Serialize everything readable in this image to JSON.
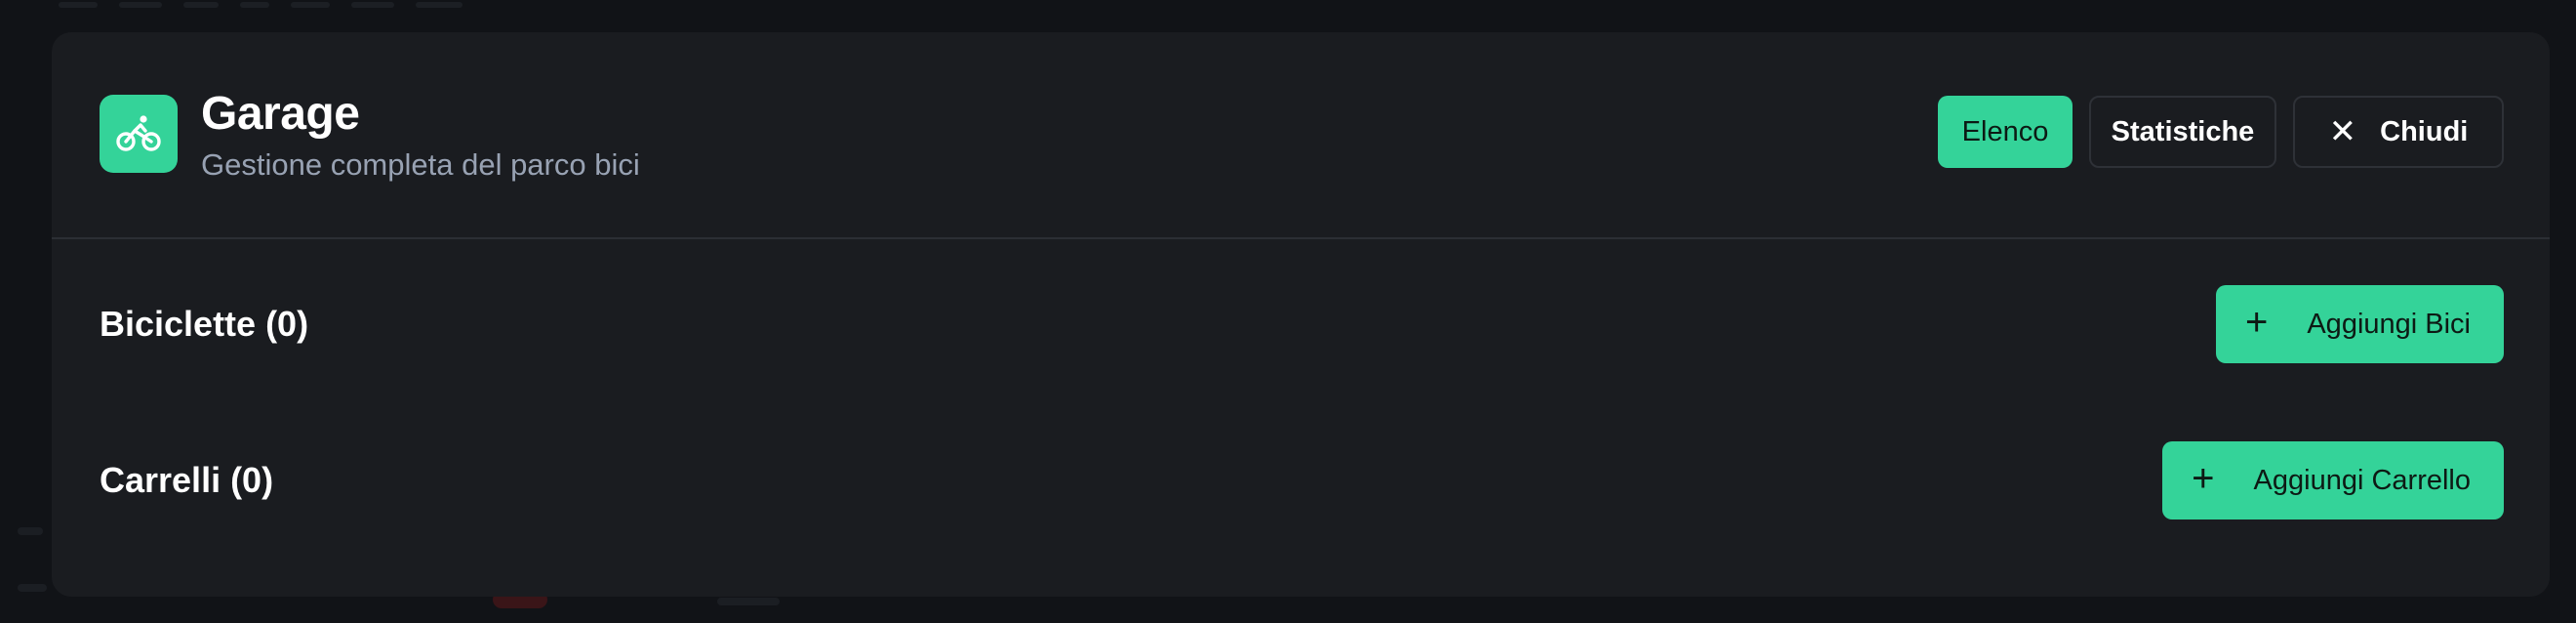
{
  "app": {
    "title": "Garage",
    "subtitle": "Gestione completa del parco bici",
    "icon": "bike-icon",
    "accent_color": "#34d399"
  },
  "header_actions": {
    "list_label": "Elenco",
    "stats_label": "Statistiche",
    "close_label": "Chiudi",
    "close_icon": "close-icon"
  },
  "sections": {
    "bikes": {
      "title": "Biciclette (0)",
      "add_label": "Aggiungi Bici",
      "add_icon": "plus-icon"
    },
    "carts": {
      "title": "Carrelli (0)",
      "add_label": "Aggiungi Carrello",
      "add_icon": "plus-icon"
    }
  }
}
